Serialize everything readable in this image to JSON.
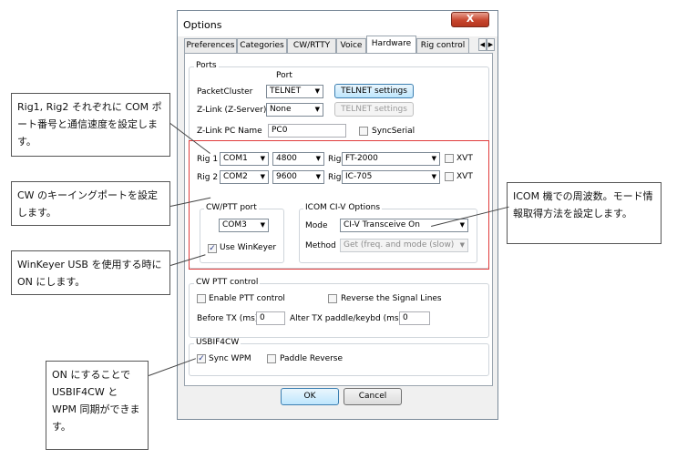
{
  "dialog": {
    "title": "Options",
    "close_label": "X",
    "tabs": [
      "Preferences",
      "Categories",
      "CW/RTTY",
      "Voice",
      "Hardware",
      "Rig control"
    ],
    "active_tab": "Hardware",
    "ports": {
      "group_label": "Ports",
      "port_header": "Port",
      "packetcluster_label": "PacketCluster",
      "packetcluster_value": "TELNET",
      "telnet_settings_label": "TELNET settings",
      "zlink_label": "Z-Link (Z-Server)",
      "zlink_value": "None",
      "telnet_settings_disabled_label": "TELNET settings",
      "zlink_pc_name_label": "Z-Link PC Name",
      "zlink_pc_name_value": "PC0",
      "syncserial_label": "SyncSerial",
      "rig1_label": "Rig 1",
      "rig1_port": "COM1",
      "rig1_baud": "4800",
      "rig1_rig_label": "Rig",
      "rig1_rig": "FT-2000",
      "rig1_xvt_label": "XVT",
      "rig2_label": "Rig 2",
      "rig2_port": "COM2",
      "rig2_baud": "9600",
      "rig2_rig_label": "Rig",
      "rig2_rig": "IC-705",
      "rig2_xvt_label": "XVT",
      "cwptt_port_group_label": "CW/PTT port",
      "cwptt_port_value": "COM3",
      "use_winkeyer_label": "Use WinKeyer",
      "icom_group_label": "ICOM CI-V Options",
      "mode_label": "Mode",
      "mode_value": "CI-V Transceive On",
      "method_label": "Method",
      "method_value": "Get (freq. and mode (slow)"
    },
    "cw_ptt_control": {
      "group_label": "CW PTT control",
      "enable_ptt_label": "Enable PTT control",
      "reverse_label": "Reverse the Signal Lines",
      "before_tx_label": "Before TX (ms)",
      "before_tx_value": "0",
      "alter_tx_label": "Alter TX paddle/keybd (ms)",
      "alter_tx_value": "0"
    },
    "usbif4cw": {
      "group_label": "USBIF4CW",
      "sync_wpm_label": "Sync WPM",
      "paddle_reverse_label": "Paddle Reverse"
    },
    "ok_label": "OK",
    "cancel_label": "Cancel"
  },
  "callouts": {
    "rig": "Rig1, Rig2 それぞれに COM ポート番号と通信速度を設定します。",
    "cw": "CW のキーイングポートを設定します。",
    "winkeyer": "WinKeyer USB を使用する時に ON にします。",
    "icom": "ICOM 機での周波数。モード情報取得方法を設定します。",
    "usbif4cw": "ON にすることで USBIF4CW と WPM 同期ができます。"
  },
  "colors": {
    "highlight_box": "#e03c3c",
    "close_button": "#c7462e"
  }
}
